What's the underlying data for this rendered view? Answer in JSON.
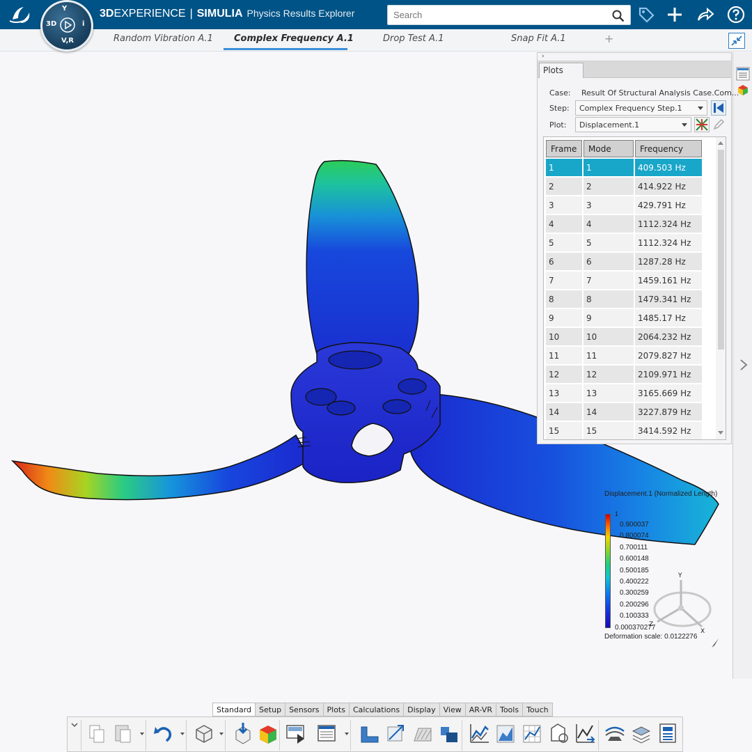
{
  "header": {
    "brand_3d": "3D",
    "brand_experience": "EXPERIENCE",
    "brand_separator": "|",
    "brand_simulia": "SIMULIA",
    "app_name": "Physics Results Explorer",
    "compass_labels": {
      "left": "3D",
      "right": "i",
      "bottom": "V,R",
      "top": "Y"
    },
    "search_placeholder": "Search",
    "accent_color": "#005386"
  },
  "doc_tabs": [
    {
      "label": "Random Vibration A.1",
      "active": false
    },
    {
      "label": "Complex Frequency A.1",
      "active": true
    },
    {
      "label": "Drop Test A.1",
      "active": false
    },
    {
      "label": "Snap Fit A.1",
      "active": false
    }
  ],
  "tab_add_label": "+",
  "panel": {
    "collapse_glyph": "›",
    "tab_label": "Plots",
    "case_label": "Case:",
    "case_value": "Result Of Structural Analysis Case.Com...",
    "step_label": "Step:",
    "step_value": "Complex Frequency Step.1",
    "plot_label": "Plot:",
    "plot_value": "Displacement.1",
    "columns": [
      "Frame",
      "Mode",
      "Frequency"
    ],
    "rows": [
      [
        "1",
        "1",
        "409.503 Hz"
      ],
      [
        "2",
        "2",
        "414.922 Hz"
      ],
      [
        "3",
        "3",
        "429.791 Hz"
      ],
      [
        "4",
        "4",
        "1112.324 Hz"
      ],
      [
        "5",
        "5",
        "1112.324 Hz"
      ],
      [
        "6",
        "6",
        "1287.28 Hz"
      ],
      [
        "7",
        "7",
        "1459.161 Hz"
      ],
      [
        "8",
        "8",
        "1479.341 Hz"
      ],
      [
        "9",
        "9",
        "1485.17 Hz"
      ],
      [
        "10",
        "10",
        "2064.232 Hz"
      ],
      [
        "11",
        "11",
        "2079.827 Hz"
      ],
      [
        "12",
        "12",
        "2109.971 Hz"
      ],
      [
        "13",
        "13",
        "3165.669 Hz"
      ],
      [
        "14",
        "14",
        "3227.879 Hz"
      ],
      [
        "15",
        "15",
        "3414.592 Hz"
      ]
    ],
    "selected_row": 0,
    "selected_color": "#18a6c9"
  },
  "legend": {
    "title": "Displacement.1 (Normalized Length)",
    "max_label": "1",
    "values": [
      "0.900037",
      "0.800074",
      "0.700111",
      "0.600148",
      "0.500185",
      "0.400222",
      "0.300259",
      "0.200296",
      "0.100333"
    ],
    "min_label": "0.000370277",
    "deformation_scale": "Deformation scale: 0.0122276",
    "axis_labels": {
      "y": "Y",
      "z": "Z",
      "x": "X"
    }
  },
  "action_tabs": [
    {
      "label": "Standard",
      "active": true
    },
    {
      "label": "Setup",
      "active": false
    },
    {
      "label": "Sensors",
      "active": false
    },
    {
      "label": "Plots",
      "active": false
    },
    {
      "label": "Calculations",
      "active": false
    },
    {
      "label": "Display",
      "active": false
    },
    {
      "label": "View",
      "active": false
    },
    {
      "label": "AR-VR",
      "active": false
    },
    {
      "label": "Tools",
      "active": false
    },
    {
      "label": "Touch",
      "active": false
    }
  ],
  "toolbar_icons": [
    "copy-icon",
    "paste-icon",
    "undo-icon",
    "part-icon",
    "import-icon",
    "colored-part-icon",
    "play-frame-icon",
    "table-icon",
    "corner-icon",
    "deform-icon",
    "hatch-icon",
    "square-icon",
    "line-chart-icon",
    "area-chart-icon",
    "grid-chart-icon",
    "probe-icon",
    "chart-arrow-icon",
    "flow-icon",
    "layers-icon",
    "sensor-icon"
  ]
}
